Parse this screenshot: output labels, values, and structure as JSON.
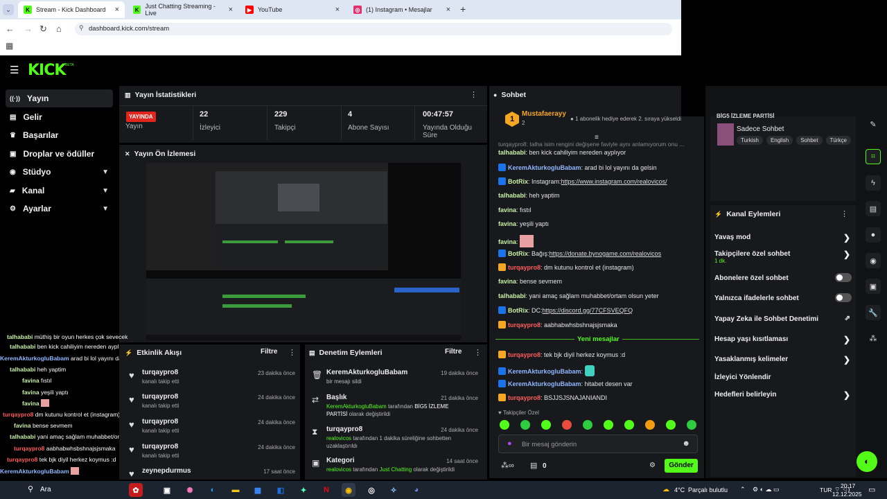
{
  "browser": {
    "tabs": [
      {
        "title": "Stream - Kick Dashboard",
        "color": "#53fc18",
        "fav": "K"
      },
      {
        "title": "Just Chatting Streaming - Live",
        "color": "#53fc18",
        "fav": "K"
      },
      {
        "title": "YouTube",
        "color": "#ff0000",
        "fav": "▶"
      },
      {
        "title": "(1) Instagram • Mesajlar",
        "color": "#e1306c",
        "fav": "◎"
      }
    ],
    "url": "dashboard.kick.com/stream",
    "new_tab": "+"
  },
  "kick": {
    "logo": "KICK",
    "beta": "BETA",
    "sidebar": [
      "Yayın",
      "Gelir",
      "Başarılar",
      "Droplar ve ödüller",
      "Stüdyo",
      "Kanal",
      "Ayarlar"
    ],
    "stats_title": "Yayın İstatistikleri",
    "live_badge": "YAYINDA",
    "stats": [
      {
        "label": "Yayın",
        "value": ""
      },
      {
        "label": "İzleyici",
        "value": "22"
      },
      {
        "label": "Takipçi",
        "value": "229"
      },
      {
        "label": "Abone Sayısı",
        "value": "4"
      },
      {
        "label": "Yayında Olduğu Süre",
        "value": "00:47:57"
      }
    ],
    "preview_title": "Yayın Ön İzlemesi",
    "activity": {
      "title": "Etkinlik Akışı",
      "filter": "Filtre",
      "items": [
        {
          "name": "turqaypro8",
          "sub": "kanalı takip etti",
          "time": "23 dakika önce"
        },
        {
          "name": "turqaypro8",
          "sub": "kanalı takip etti",
          "time": "24 dakika önce"
        },
        {
          "name": "turqaypro8",
          "sub": "kanalı takip etti",
          "time": "24 dakika önce"
        },
        {
          "name": "turqaypro8",
          "sub": "kanalı takip etti",
          "time": "24 dakika önce"
        },
        {
          "name": "zeynepdurmus",
          "sub": "",
          "time": "17 saat önce"
        }
      ]
    },
    "moderation": {
      "title": "Denetim Eylemleri",
      "filter": "Filtre",
      "items": [
        {
          "name": "KeremAkturkogluBabam",
          "sub": "bir mesajı sildi",
          "time": "19 dakika önce",
          "icon": "🗑"
        },
        {
          "name": "Başlık",
          "sub_user": "KeremAkturkogluBabam",
          "sub_mid": " tarafından ",
          "sub_val": "BİG5 İZLEME PARTİSİ",
          "sub_end": " olarak değiştirildi",
          "time": "21 dakika önce",
          "icon": "⇄"
        },
        {
          "name": "turqaypro8",
          "sub_user": "realovicos",
          "sub_mid": " tarafından 1 dakika süreliğine sohbetten uzaklaştırıldı",
          "time": "24 dakika önce",
          "icon": "⧗"
        },
        {
          "name": "Kategori",
          "sub_user": "realovicos",
          "sub_mid": " tarafından ",
          "sub_val": "Just Chatting",
          "sub_end": " olarak değiştirildi",
          "time": "14 saat önce",
          "icon": "▣"
        }
      ]
    },
    "chat": {
      "title": "Sohbet",
      "pinned_user": "Mustafaerayy",
      "pinned_count": "2",
      "pinned_text": "1 abonelik hediye ederek 2. sıraya yükseldi",
      "ghost_line": "turqaypro8: talha isim rengini değişene faviyle aynı anlamıyorum onu ...",
      "lines": [
        {
          "user": "talhababi",
          "ucolor": "#c9f2a6",
          "badge": "",
          "text": "ben kick cahiliyim nereden ayplıyor"
        },
        {
          "user": "KeremAkturkogluBabam",
          "ucolor": "#8fb7ff",
          "badge": "#1a73e8",
          "text": "arad bi lol yayını da gelsin"
        },
        {
          "user": "BotRix",
          "ucolor": "#c9f2a6",
          "badge": "#1a73e8",
          "text": "Instagram:",
          "link": "https://www.instagram.com/realovicos/"
        },
        {
          "user": "talhababi",
          "ucolor": "#c9f2a6",
          "badge": "",
          "text": "heh yaptim"
        },
        {
          "user": "favina",
          "ucolor": "#c9f2a6",
          "badge": "",
          "text": "fıstıl"
        },
        {
          "user": "favina",
          "ucolor": "#c9f2a6",
          "badge": "",
          "text": "yeşili yaptı"
        },
        {
          "user": "favina",
          "ucolor": "#c9f2a6",
          "badge": "",
          "text": "",
          "emote": true
        },
        {
          "user": "BotRix",
          "ucolor": "#c9f2a6",
          "badge": "#1a73e8",
          "text": "Bağış:",
          "link": "https://donate.bynogame.com/realovicos"
        },
        {
          "user": "turqaypro8",
          "ucolor": "#ff5c5c",
          "badge": "#f5a623",
          "text": "dm kutunu kontrol et (instagram)"
        },
        {
          "user": "favina",
          "ucolor": "#c9f2a6",
          "badge": "",
          "text": "bense sevmem"
        },
        {
          "user": "talhababi",
          "ucolor": "#c9f2a6",
          "badge": "",
          "text": "yani amaç sağlam muhabbet/ortam olsun yeter"
        },
        {
          "user": "BotRix",
          "ucolor": "#c9f2a6",
          "badge": "#1a73e8",
          "text": "DC:",
          "link": "https://discord.gg/77CFSVEQFQ"
        },
        {
          "user": "turqaypro8",
          "ucolor": "#ff5c5c",
          "badge": "#f5a623",
          "text": "aabhabwhsbshnajsjsmaka"
        }
      ],
      "new_messages": "Yeni mesajlar",
      "new_lines": [
        {
          "user": "turqaypro8",
          "ucolor": "#ff5c5c",
          "badge": "#f5a623",
          "text": "tek bjk diyil herkez koymus :d"
        },
        {
          "user": "KeremAkturkogluBabam",
          "ucolor": "#8fb7ff",
          "badge": "#1a73e8",
          "text": "",
          "emote": true
        },
        {
          "user": "KeremAkturkogluBabam",
          "ucolor": "#8fb7ff",
          "badge": "#1a73e8",
          "text": "hitabet desen var"
        },
        {
          "user": "turqaypro8",
          "ucolor": "#ff5c5c",
          "badge": "#f5a623",
          "text": "BSJJSJSNAJANIANDI"
        }
      ],
      "followers_only": "Takipçiler Özel",
      "input_placeholder": "Bir mesaj gönderin",
      "points": "0",
      "send": "Gönder"
    },
    "session": {
      "title": "BİG5 İZLEME PARTİSİ",
      "subtitle": "Sadece Sohbet",
      "tags": [
        "Turkish",
        "English",
        "Sohbet",
        "Türkçe"
      ]
    },
    "channel_actions": {
      "title": "Kanal Eylemleri",
      "items": [
        {
          "label": "Yavaş mod",
          "ctl": "chev"
        },
        {
          "label": "Takipçilere özel sohbet",
          "sub": "1 dk.",
          "ctl": "chev"
        },
        {
          "label": "Abonelere özel sohbet",
          "ctl": "toggle"
        },
        {
          "label": "Yalnızca ifadelerle sohbet",
          "ctl": "toggle"
        },
        {
          "label": "Yapay Zeka ile Sohbet Denetimi",
          "ctl": "ext"
        },
        {
          "label": "Hesap yaşı kısıtlaması",
          "ctl": "chev"
        },
        {
          "label": "Yasaklanmış kelimeler",
          "ctl": "chev"
        },
        {
          "label": "İzleyici Yönlendir",
          "ctl": ""
        },
        {
          "label": "Hedefleri belirleyin",
          "ctl": "chev"
        }
      ]
    }
  },
  "overlay_chat": [
    {
      "user": "talhababi",
      "text": "müthiş bir oyun herkes çok sevecek",
      "ucolor": "#c9f2a6"
    },
    {
      "user": "talhababi",
      "text": "ben kick cahiliyim nereden ayplıyor",
      "ucolor": "#c9f2a6"
    },
    {
      "user": "KeremAkturkogluBabam",
      "text": "arad bi lol yayını da gelsin",
      "ucolor": "#8fb7ff"
    },
    {
      "user": "talhababi",
      "text": "heh yaptim",
      "ucolor": "#c9f2a6"
    },
    {
      "user": "favina",
      "text": "fıstıl",
      "ucolor": "#c9f2a6"
    },
    {
      "user": "favina",
      "text": "yeşili yaptı",
      "ucolor": "#c9f2a6"
    },
    {
      "user": "favina",
      "text": "",
      "ucolor": "#c9f2a6"
    },
    {
      "user": "turqaypro8",
      "text": "dm kutunu kontrol et (instagram)",
      "ucolor": "#ff5c5c"
    },
    {
      "user": "favina",
      "text": "bense sevmem",
      "ucolor": "#c9f2a6"
    },
    {
      "user": "talhababi",
      "text": "yani amaç sağlam muhabbet/ortam olsun yeter",
      "ucolor": "#c9f2a6"
    },
    {
      "user": "turqaypro8",
      "text": "aabhabwhsbshnajsjsmaka",
      "ucolor": "#ff5c5c"
    },
    {
      "user": "turqaypro8",
      "text": "tek bjk diyil herkez koymus :d",
      "ucolor": "#ff5c5c"
    },
    {
      "user": "KeremAkturkogluBabam",
      "text": "",
      "ucolor": "#8fb7ff"
    },
    {
      "user": "turqaypro8",
      "text": "BSJJSJSNAJANIANDI",
      "ucolor": "#ff5c5c"
    }
  ],
  "taskbar": {
    "search": "Ara",
    "weather_temp": "4°C",
    "weather_text": "Parçalı bulutlu",
    "lang": "TUR",
    "time": "20:17",
    "date": "12.12.2025"
  }
}
